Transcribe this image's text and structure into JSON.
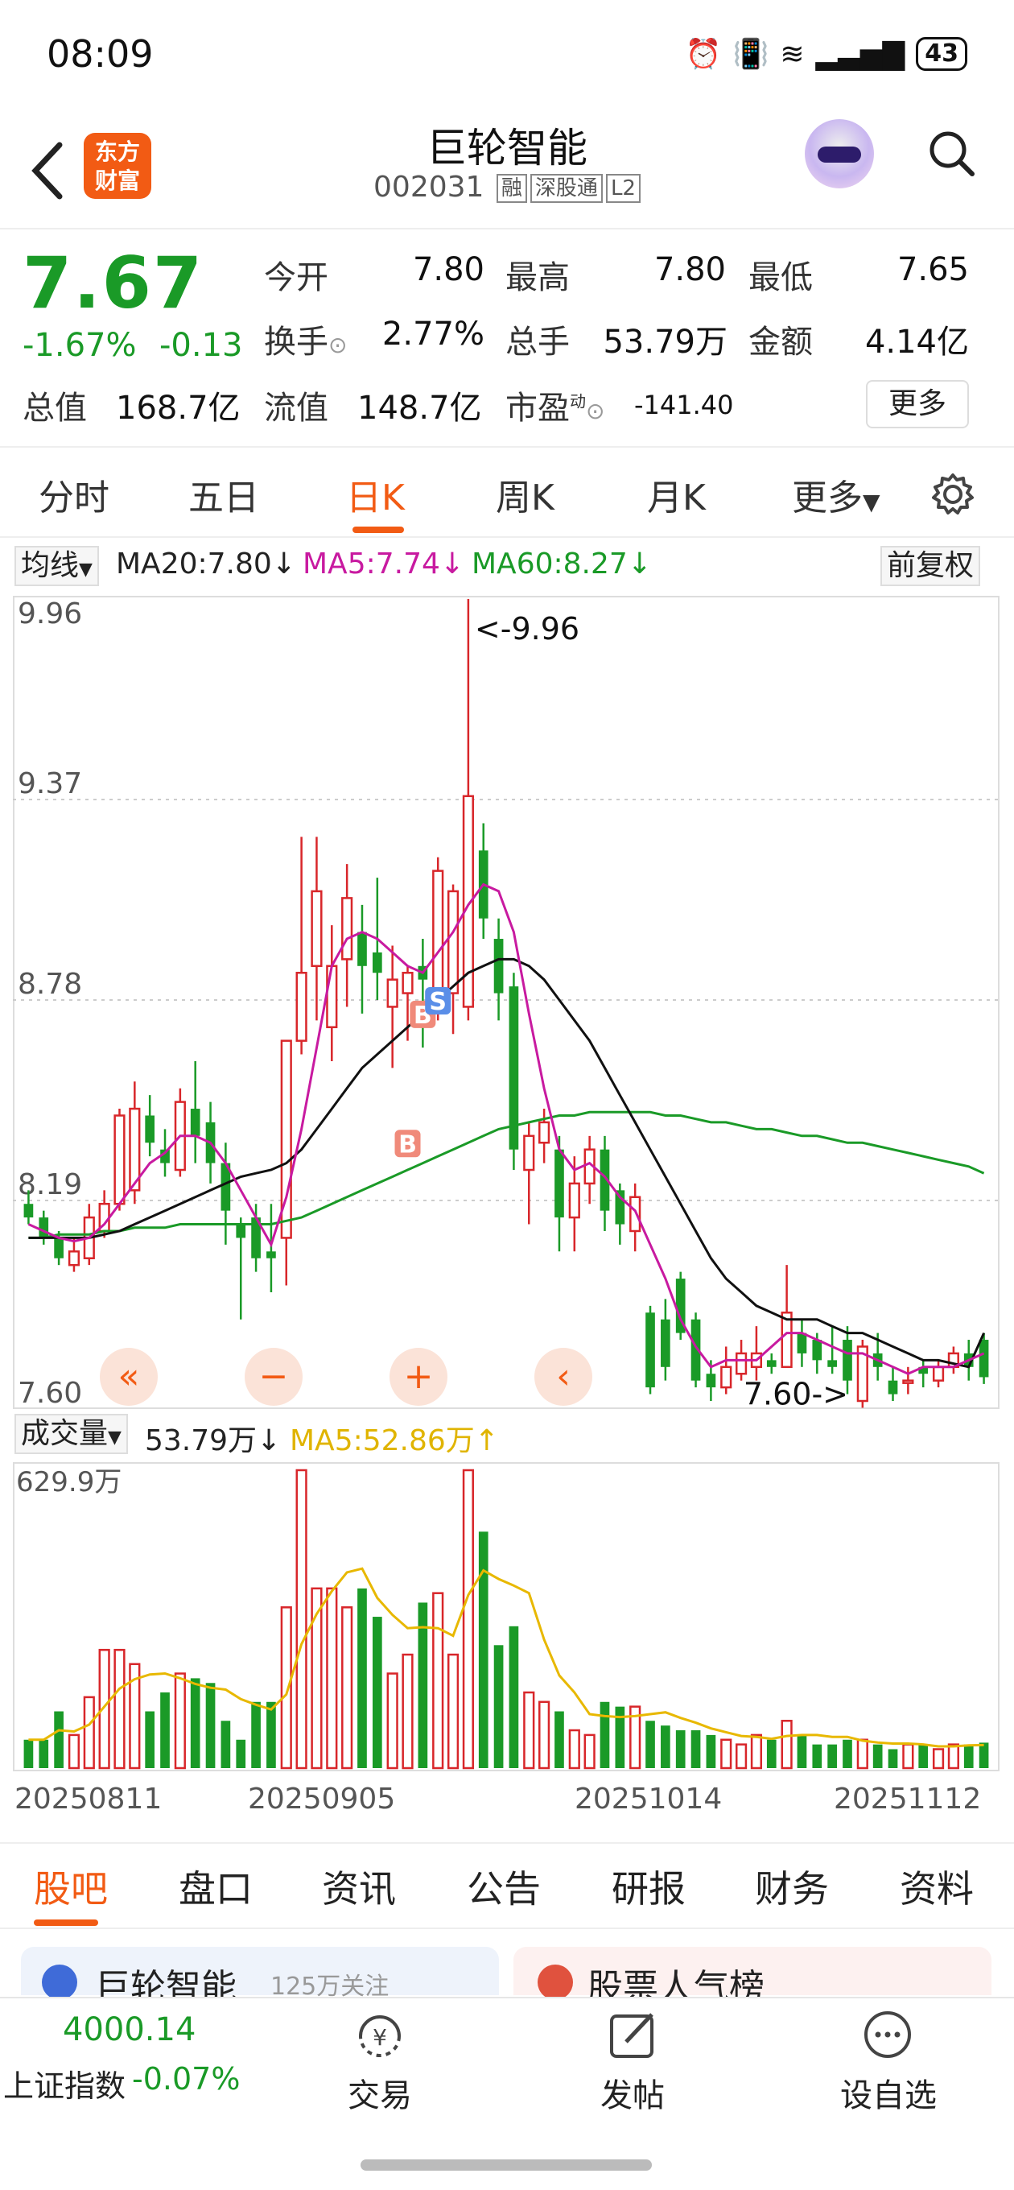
{
  "status_bar": {
    "time": "08:09",
    "battery": "43"
  },
  "header": {
    "logo_text_1": "东方",
    "logo_text_2": "财富",
    "stock_name": "巨轮智能",
    "code": "002031",
    "tags": [
      "融",
      "深股通",
      "L2"
    ]
  },
  "quote": {
    "price": "7.67",
    "change_pct": "-1.67%",
    "change_abs": "-0.13",
    "rows": [
      [
        {
          "label": "今开",
          "value": "7.80"
        },
        {
          "label": "最高",
          "value": "7.80"
        },
        {
          "label": "最低",
          "value": "7.65"
        }
      ],
      [
        {
          "label": "换手",
          "value": "2.77%"
        },
        {
          "label": "总手",
          "value": "53.79万"
        },
        {
          "label": "金额",
          "value": "4.14亿"
        }
      ]
    ],
    "total_value_label": "总值",
    "total_value": "168.7亿",
    "float_value_label": "流值",
    "float_value": "148.7亿",
    "pe_label": "市盈",
    "pe_sup": "动",
    "pe_value": "-141.40",
    "more": "更多"
  },
  "tabs": [
    "分时",
    "五日",
    "日K",
    "周K",
    "月K",
    "更多"
  ],
  "active_tab": "日K",
  "ma_bar": {
    "selector": "均线",
    "ma20": "MA20:7.80↓",
    "ma5": "MA5:7.74↓",
    "ma60": "MA60:8.27↓",
    "adjust": "前复权"
  },
  "kchart": {
    "y_top": "9.96",
    "y_2": "9.37",
    "y_3": "8.78",
    "y_4": "8.19",
    "y_bottom": "7.60",
    "max_note": "<-9.96",
    "min_note": "7.60->",
    "buy_mark": "B",
    "sell_mark": "S"
  },
  "vol_bar": {
    "selector": "成交量",
    "vol": "53.79万↓",
    "ma5": "MA5:52.86万↑",
    "max": "629.9万"
  },
  "dates": [
    "20250811",
    "20250905",
    "20251014",
    "20251112"
  ],
  "subtabs": [
    "股吧",
    "盘口",
    "资讯",
    "公告",
    "研报",
    "财务",
    "资料"
  ],
  "cards": {
    "left": "巨轮智能",
    "left_sub": "125万关注",
    "right": "股票人气榜"
  },
  "bottom": {
    "index_value": "4000.14",
    "index_name": "上证指数",
    "index_chg": "-0.07%",
    "trade": "交易",
    "post": "发帖",
    "watch": "设自选"
  },
  "chart_data": {
    "type": "candlestick",
    "ylim": [
      7.6,
      9.96
    ],
    "candles": [
      [
        8.18,
        8.14,
        8.22,
        8.12
      ],
      [
        8.14,
        8.08,
        8.16,
        8.06
      ],
      [
        8.08,
        8.02,
        8.1,
        8.0
      ],
      [
        8.0,
        8.04,
        8.08,
        7.98
      ],
      [
        8.02,
        8.14,
        8.18,
        8.0
      ],
      [
        8.1,
        8.18,
        8.22,
        8.08
      ],
      [
        8.18,
        8.44,
        8.46,
        8.16
      ],
      [
        8.22,
        8.46,
        8.54,
        8.18
      ],
      [
        8.44,
        8.36,
        8.5,
        8.32
      ],
      [
        8.34,
        8.3,
        8.4,
        8.26
      ],
      [
        8.28,
        8.48,
        8.52,
        8.26
      ],
      [
        8.46,
        8.38,
        8.6,
        8.3
      ],
      [
        8.42,
        8.3,
        8.48,
        8.24
      ],
      [
        8.3,
        8.16,
        8.36,
        8.06
      ],
      [
        8.12,
        8.08,
        8.14,
        7.84
      ],
      [
        8.14,
        8.02,
        8.18,
        7.98
      ],
      [
        8.04,
        8.02,
        8.18,
        7.92
      ],
      [
        8.08,
        8.66,
        8.66,
        7.94
      ],
      [
        8.66,
        8.86,
        9.26,
        8.62
      ],
      [
        8.88,
        9.1,
        9.26,
        8.72
      ],
      [
        8.7,
        8.88,
        9.0,
        8.6
      ],
      [
        8.9,
        9.08,
        9.18,
        8.76
      ],
      [
        8.98,
        8.88,
        9.06,
        8.74
      ],
      [
        8.92,
        8.86,
        9.14,
        8.78
      ],
      [
        8.76,
        8.84,
        8.94,
        8.58
      ],
      [
        8.8,
        8.86,
        8.88,
        8.66
      ],
      [
        8.88,
        8.84,
        8.96,
        8.64
      ],
      [
        8.78,
        9.16,
        9.2,
        8.72
      ],
      [
        8.8,
        9.1,
        9.12,
        8.68
      ],
      [
        8.76,
        9.38,
        9.96,
        8.72
      ],
      [
        9.22,
        9.02,
        9.3,
        8.96
      ],
      [
        8.96,
        8.8,
        9.02,
        8.72
      ],
      [
        8.82,
        8.34,
        8.86,
        8.28
      ],
      [
        8.28,
        8.38,
        8.42,
        8.12
      ],
      [
        8.36,
        8.42,
        8.46,
        8.3
      ],
      [
        8.34,
        8.14,
        8.38,
        8.04
      ],
      [
        8.14,
        8.24,
        8.32,
        8.04
      ],
      [
        8.24,
        8.34,
        8.38,
        8.18
      ],
      [
        8.34,
        8.16,
        8.38,
        8.1
      ],
      [
        8.22,
        8.12,
        8.24,
        8.06
      ],
      [
        8.1,
        8.2,
        8.24,
        8.04
      ],
      [
        7.86,
        7.64,
        7.88,
        7.62
      ],
      [
        7.84,
        7.7,
        7.9,
        7.66
      ],
      [
        7.96,
        7.8,
        7.98,
        7.78
      ],
      [
        7.84,
        7.66,
        7.86,
        7.64
      ],
      [
        7.68,
        7.64,
        7.72,
        7.6
      ],
      [
        7.64,
        7.7,
        7.76,
        7.62
      ],
      [
        7.68,
        7.74,
        7.78,
        7.66
      ],
      [
        7.7,
        7.74,
        7.82,
        7.66
      ],
      [
        7.72,
        7.7,
        7.74,
        7.68
      ],
      [
        7.7,
        7.86,
        8.0,
        7.7
      ],
      [
        7.8,
        7.74,
        7.84,
        7.7
      ],
      [
        7.78,
        7.72,
        7.8,
        7.68
      ],
      [
        7.72,
        7.7,
        7.82,
        7.68
      ],
      [
        7.78,
        7.66,
        7.82,
        7.62
      ],
      [
        7.6,
        7.76,
        7.78,
        7.58
      ],
      [
        7.74,
        7.7,
        7.8,
        7.66
      ],
      [
        7.66,
        7.62,
        7.7,
        7.6
      ],
      [
        7.66,
        7.66,
        7.7,
        7.62
      ],
      [
        7.7,
        7.68,
        7.72,
        7.64
      ],
      [
        7.66,
        7.7,
        7.72,
        7.64
      ],
      [
        7.7,
        7.74,
        7.76,
        7.68
      ],
      [
        7.74,
        7.7,
        7.78,
        7.66
      ],
      [
        7.78,
        7.67,
        7.8,
        7.65
      ]
    ],
    "ma5": [
      8.12,
      8.1,
      8.08,
      8.07,
      8.08,
      8.12,
      8.18,
      8.24,
      8.3,
      8.33,
      8.38,
      8.38,
      8.36,
      8.3,
      8.22,
      8.14,
      8.06,
      8.2,
      8.4,
      8.64,
      8.88,
      8.96,
      8.98,
      8.96,
      8.92,
      8.88,
      8.86,
      8.92,
      8.98,
      9.06,
      9.12,
      9.1,
      8.98,
      8.74,
      8.52,
      8.34,
      8.28,
      8.3,
      8.26,
      8.2,
      8.16,
      8.06,
      7.96,
      7.84,
      7.76,
      7.7,
      7.72,
      7.72,
      7.72,
      7.76,
      7.8,
      7.8,
      7.78,
      7.76,
      7.74,
      7.74,
      7.72,
      7.7,
      7.68,
      7.7,
      7.7,
      7.7,
      7.72,
      7.74
    ],
    "ma20": [
      8.08,
      8.08,
      8.08,
      8.08,
      8.08,
      8.09,
      8.1,
      8.12,
      8.14,
      8.16,
      8.18,
      8.2,
      8.22,
      8.24,
      8.26,
      8.27,
      8.28,
      8.3,
      8.34,
      8.4,
      8.46,
      8.52,
      8.58,
      8.62,
      8.66,
      8.7,
      8.74,
      8.78,
      8.82,
      8.86,
      8.88,
      8.9,
      8.9,
      8.88,
      8.84,
      8.78,
      8.72,
      8.66,
      8.58,
      8.5,
      8.42,
      8.34,
      8.26,
      8.18,
      8.1,
      8.02,
      7.96,
      7.92,
      7.88,
      7.86,
      7.84,
      7.84,
      7.84,
      7.82,
      7.8,
      7.8,
      7.78,
      7.76,
      7.74,
      7.72,
      7.72,
      7.71,
      7.7,
      7.8
    ],
    "ma60": [
      8.08,
      8.08,
      8.09,
      8.09,
      8.09,
      8.1,
      8.1,
      8.11,
      8.11,
      8.11,
      8.12,
      8.12,
      8.12,
      8.12,
      8.12,
      8.12,
      8.12,
      8.13,
      8.14,
      8.16,
      8.18,
      8.2,
      8.22,
      8.24,
      8.26,
      8.28,
      8.3,
      8.32,
      8.34,
      8.36,
      8.38,
      8.4,
      8.41,
      8.42,
      8.43,
      8.44,
      8.44,
      8.45,
      8.45,
      8.45,
      8.45,
      8.45,
      8.44,
      8.44,
      8.43,
      8.42,
      8.42,
      8.41,
      8.4,
      8.4,
      8.39,
      8.38,
      8.38,
      8.37,
      8.36,
      8.36,
      8.35,
      8.34,
      8.33,
      8.32,
      8.31,
      8.3,
      8.29,
      8.27
    ],
    "volume": [
      60,
      60,
      120,
      70,
      150,
      250,
      250,
      220,
      120,
      160,
      200,
      190,
      180,
      100,
      60,
      140,
      140,
      340,
      630,
      380,
      380,
      340,
      380,
      320,
      200,
      240,
      350,
      370,
      240,
      630,
      500,
      260,
      300,
      160,
      140,
      120,
      80,
      70,
      140,
      130,
      130,
      100,
      90,
      80,
      80,
      70,
      60,
      50,
      70,
      60,
      100,
      70,
      50,
      50,
      60,
      60,
      50,
      40,
      50,
      50,
      40,
      50,
      50,
      53.79
    ]
  }
}
